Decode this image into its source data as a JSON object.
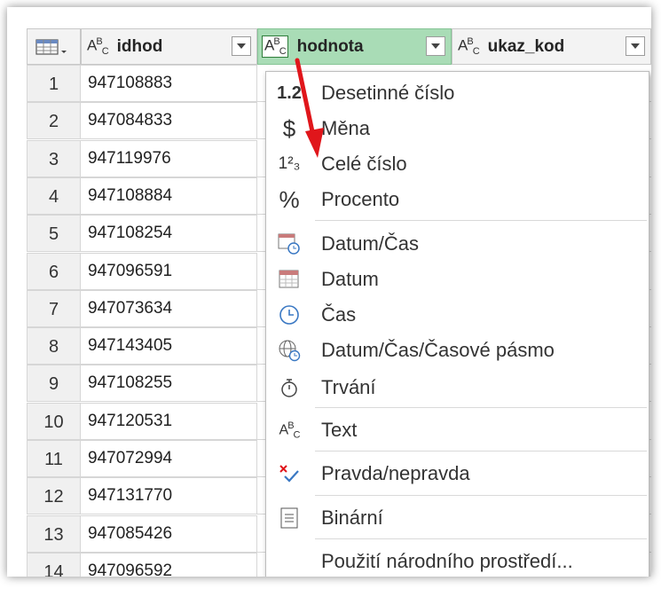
{
  "columns": [
    {
      "name": "idhod",
      "type_icon": "abc-type-icon"
    },
    {
      "name": "hodnota",
      "type_icon": "abc-type-icon"
    },
    {
      "name": "ukaz_kod",
      "type_icon": "abc-type-icon"
    }
  ],
  "type_prefix": {
    "a": "A",
    "b": "B",
    "c": "C"
  },
  "rows": [
    {
      "n": "1",
      "idhod": "947108883"
    },
    {
      "n": "2",
      "idhod": "947084833"
    },
    {
      "n": "3",
      "idhod": "947119976"
    },
    {
      "n": "4",
      "idhod": "947108884"
    },
    {
      "n": "5",
      "idhod": "947108254"
    },
    {
      "n": "6",
      "idhod": "947096591"
    },
    {
      "n": "7",
      "idhod": "947073634"
    },
    {
      "n": "8",
      "idhod": "947143405"
    },
    {
      "n": "9",
      "idhod": "947108255"
    },
    {
      "n": "10",
      "idhod": "947120531"
    },
    {
      "n": "11",
      "idhod": "947072994"
    },
    {
      "n": "12",
      "idhod": "947131770"
    },
    {
      "n": "13",
      "idhod": "947085426"
    },
    {
      "n": "14",
      "idhod": "947096592"
    }
  ],
  "menu": {
    "items": [
      {
        "label": "Desetinné číslo",
        "icon": "decimal-icon",
        "glyph": "1.2"
      },
      {
        "label": "Měna",
        "icon": "currency-icon",
        "glyph": "$"
      },
      {
        "label": "Celé číslo",
        "icon": "whole-number-icon",
        "glyph": "1²₃"
      },
      {
        "label": "Procento",
        "icon": "percent-icon",
        "glyph": "%"
      },
      {
        "label": "Datum/Čas",
        "icon": "datetime-icon"
      },
      {
        "label": "Datum",
        "icon": "date-icon"
      },
      {
        "label": "Čas",
        "icon": "time-icon"
      },
      {
        "label": "Datum/Čas/Časové pásmo",
        "icon": "datetimezone-icon"
      },
      {
        "label": "Trvání",
        "icon": "duration-icon"
      },
      {
        "label": "Text",
        "icon": "text-icon"
      },
      {
        "label": "Pravda/nepravda",
        "icon": "boolean-icon"
      },
      {
        "label": "Binární",
        "icon": "binary-icon"
      },
      {
        "label": "Použití národního prostředí...",
        "icon": ""
      }
    ]
  },
  "colors": {
    "selected_header": "#a9dcb6",
    "arrow": "#e0161b"
  }
}
